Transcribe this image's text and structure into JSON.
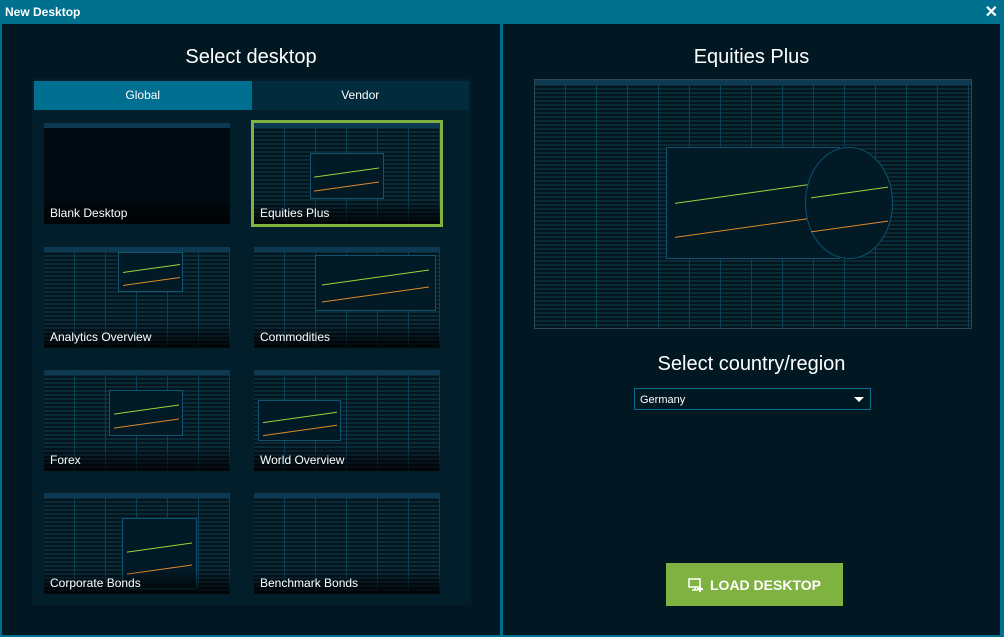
{
  "window": {
    "title": "New Desktop",
    "close_icon": "close-icon"
  },
  "left": {
    "heading": "Select desktop",
    "tabs": [
      {
        "label": "Global",
        "active": true
      },
      {
        "label": "Vendor",
        "active": false
      }
    ],
    "tiles": [
      {
        "label": "Blank Desktop"
      },
      {
        "label": "Equities Plus",
        "selected": true
      },
      {
        "label": "Analytics Overview"
      },
      {
        "label": "Commodities"
      },
      {
        "label": "Forex"
      },
      {
        "label": "World Overview"
      },
      {
        "label": "Corporate Bonds"
      },
      {
        "label": "Benchmark Bonds"
      }
    ]
  },
  "right": {
    "heading": "Equities Plus",
    "region_heading": "Select country/region",
    "region_value": "Germany",
    "load_label": "LOAD DESKTOP"
  },
  "colors": {
    "accent": "#00708f",
    "button": "#7fb241",
    "selected_outline": "#7fb241",
    "background": "#011721"
  }
}
